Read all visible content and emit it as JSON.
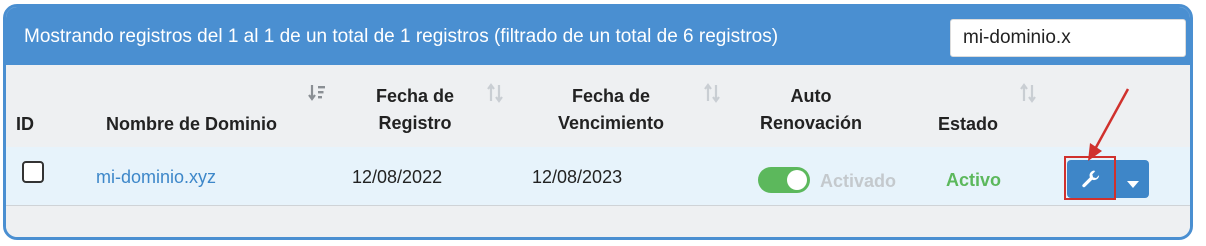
{
  "header": {
    "info_text": "Mostrando registros del 1 al 1 de un total de 1 registros (filtrado de un total de 6 registros)",
    "search_value": "mi-dominio.x"
  },
  "columns": {
    "id": "ID",
    "domain": "Nombre de Dominio",
    "registration_line1": "Fecha de",
    "registration_line2": "Registro",
    "expiry_line1": "Fecha de",
    "expiry_line2": "Vencimiento",
    "auto_line1": "Auto",
    "auto_line2": "Renovación",
    "status": "Estado"
  },
  "row": {
    "domain": "mi-dominio.xyz",
    "registration_date": "12/08/2022",
    "expiry_date": "12/08/2023",
    "auto_renew_label": "Activado",
    "status": "Activo"
  },
  "icons": {
    "sort_domain": "sort-amount-down-icon",
    "sort_generic": "sort-icon",
    "action": "wrench-icon",
    "dropdown": "caret-down-icon"
  },
  "colors": {
    "primary": "#4a8fd1",
    "button": "#3e86c8",
    "success": "#5cb85c",
    "link": "#3d87c9",
    "highlight": "#d0312d"
  }
}
